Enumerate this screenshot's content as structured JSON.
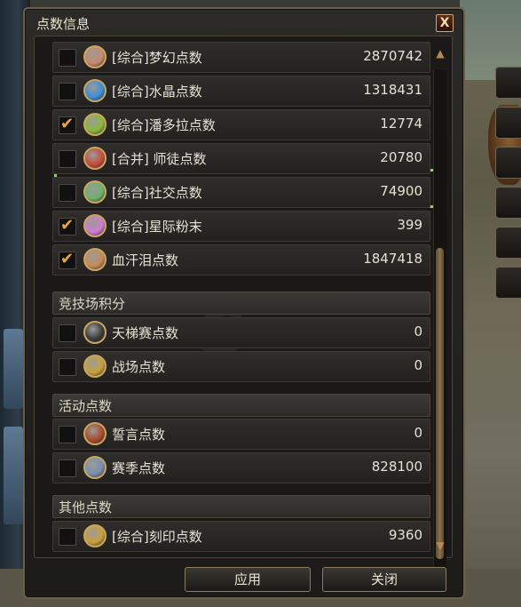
{
  "window": {
    "title": "点数信息",
    "close_label": "X"
  },
  "rows_top": [
    {
      "label": "[综合]梦幻点数",
      "value": "2870742",
      "checked": false,
      "icon": "dream-crystal-icon",
      "color": "#c98a6b"
    },
    {
      "label": "[综合]水晶点数",
      "value": "1318431",
      "checked": false,
      "icon": "blue-crystal-icon",
      "color": "#3a8fd9"
    },
    {
      "label": "[综合]潘多拉点数",
      "value": "12774",
      "checked": true,
      "icon": "pandora-icon",
      "color": "#8ab83a"
    },
    {
      "label": "[合并] 师徒点数",
      "value": "20780",
      "checked": false,
      "icon": "mentor-icon",
      "color": "#c94b3b"
    },
    {
      "label": "[综合]社交点数",
      "value": "74900",
      "checked": false,
      "icon": "social-icon",
      "color": "#6bb36b"
    },
    {
      "label": "[综合]星际粉末",
      "value": "399",
      "checked": true,
      "icon": "star-powder-icon",
      "color": "#d07bd0"
    },
    {
      "label": "血汗泪点数",
      "value": "1847418",
      "checked": true,
      "icon": "sweat-tear-icon",
      "color": "#c78b55"
    }
  ],
  "section_arena": "竞技场积分",
  "rows_arena": [
    {
      "label": "天梯赛点数",
      "value": "0",
      "checked": false,
      "icon": "ladder-icon",
      "color": "#3a3a3a"
    },
    {
      "label": "战场点数",
      "value": "0",
      "checked": false,
      "icon": "battlefield-icon",
      "color": "#c8a03a"
    }
  ],
  "section_activity": "活动点数",
  "rows_activity": [
    {
      "label": "誓言点数",
      "value": "0",
      "checked": false,
      "icon": "oath-icon",
      "color": "#a84a2a"
    },
    {
      "label": "赛季点数",
      "value": "828100",
      "checked": false,
      "icon": "season-icon",
      "color": "#7a8fb0"
    }
  ],
  "section_other": "其他点数",
  "rows_other": [
    {
      "label": "[综合]刻印点数",
      "value": "9360",
      "checked": false,
      "icon": "engrave-icon",
      "color": "#c8a03a"
    }
  ],
  "buttons": {
    "apply": "应用",
    "close": "关闭"
  },
  "check_mark": "✔"
}
